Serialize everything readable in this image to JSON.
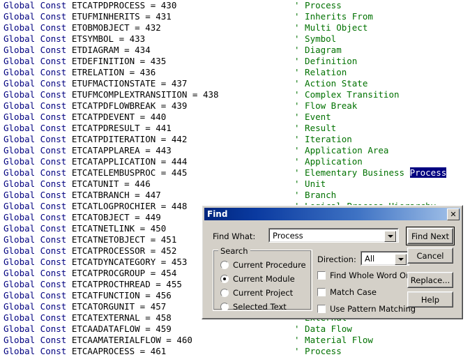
{
  "editor": {
    "keyword": "Global Const",
    "lines": [
      {
        "code": "Global Const ETCATPDPROCESS = 430",
        "ident": "ETCATPDPROCESS",
        "value": "430",
        "comment": "' Process"
      },
      {
        "code": "Global Const ETUFMINHERITS = 431",
        "ident": "ETUFMINHERITS",
        "value": "431",
        "comment": "' Inherits From"
      },
      {
        "code": "Global Const ETOBMOBJECT = 432",
        "ident": "ETOBMOBJECT",
        "value": "432",
        "comment": "' Multi Object"
      },
      {
        "code": "Global Const ETSYMBOL = 433",
        "ident": "ETSYMBOL",
        "value": "433",
        "comment": "' Symbol"
      },
      {
        "code": "Global Const ETDIAGRAM = 434",
        "ident": "ETDIAGRAM",
        "value": "434",
        "comment": "' Diagram"
      },
      {
        "code": "Global Const ETDEFINITION = 435",
        "ident": "ETDEFINITION",
        "value": "435",
        "comment": "' Definition"
      },
      {
        "code": "Global Const ETRELATION = 436",
        "ident": "ETRELATION",
        "value": "436",
        "comment": "' Relation"
      },
      {
        "code": "Global Const ETUFMACTIONSTATE = 437",
        "ident": "ETUFMACTIONSTATE",
        "value": "437",
        "comment": "' Action State"
      },
      {
        "code": "Global Const ETUFMCOMPLEXTRANSITION = 438",
        "ident": "ETUFMCOMPLEXTRANSITION",
        "value": "438",
        "comment": "' Complex Transition"
      },
      {
        "code": "Global Const ETCATPDFLOWBREAK = 439",
        "ident": "ETCATPDFLOWBREAK",
        "value": "439",
        "comment": "' Flow Break"
      },
      {
        "code": "Global Const ETCATPDEVENT = 440",
        "ident": "ETCATPDEVENT",
        "value": "440",
        "comment": "' Event"
      },
      {
        "code": "Global Const ETCATPDRESULT = 441",
        "ident": "ETCATPDRESULT",
        "value": "441",
        "comment": "' Result"
      },
      {
        "code": "Global Const ETCATPDITERATION = 442",
        "ident": "ETCATPDITERATION",
        "value": "442",
        "comment": "' Iteration"
      },
      {
        "code": "Global Const ETCATAPPLAREA = 443",
        "ident": "ETCATAPPLAREA",
        "value": "443",
        "comment": "' Application Area"
      },
      {
        "code": "Global Const ETCATAPPLICATION = 444",
        "ident": "ETCATAPPLICATION",
        "value": "444",
        "comment": "' Application"
      },
      {
        "code": "Global Const ETCATELEMBUSPROC = 445",
        "ident": "ETCATELEMBUSPROC",
        "value": "445",
        "comment": "' Elementary Business Process",
        "comment_prefix": "' Elementary Business ",
        "comment_highlight": "Process"
      },
      {
        "code": "Global Const ETCATUNIT = 446",
        "ident": "ETCATUNIT",
        "value": "446",
        "comment": "' Unit"
      },
      {
        "code": "Global Const ETCATBRANCH = 447",
        "ident": "ETCATBRANCH",
        "value": "447",
        "comment": "' Branch"
      },
      {
        "code": "Global Const ETCATLOGPROCHIER = 448",
        "ident": "ETCATLOGPROCHIER",
        "value": "448",
        "comment": "' Logical Process Hierarchy"
      },
      {
        "code": "Global Const ETCATOBJECT = 449",
        "ident": "ETCATOBJECT",
        "value": "449",
        "comment": ""
      },
      {
        "code": "Global Const ETCATNETLINK = 450",
        "ident": "ETCATNETLINK",
        "value": "450",
        "comment": ""
      },
      {
        "code": "Global Const ETCATNETOBJECT = 451",
        "ident": "ETCATNETOBJECT",
        "value": "451",
        "comment": ""
      },
      {
        "code": "Global Const ETCATPROCESSOR = 452",
        "ident": "ETCATPROCESSOR",
        "value": "452",
        "comment": ""
      },
      {
        "code": "Global Const ETCATDYNCATEGORY = 453",
        "ident": "ETCATDYNCATEGORY",
        "value": "453",
        "comment": ""
      },
      {
        "code": "Global Const ETCATPROCGROUP = 454",
        "ident": "ETCATPROCGROUP",
        "value": "454",
        "comment": ""
      },
      {
        "code": "Global Const ETCATPROCTHREAD = 455",
        "ident": "ETCATPROCTHREAD",
        "value": "455",
        "comment": ""
      },
      {
        "code": "Global Const ETCATFUNCTION = 456",
        "ident": "ETCATFUNCTION",
        "value": "456",
        "comment": ""
      },
      {
        "code": "Global Const ETCATORGUNIT = 457",
        "ident": "ETCATORGUNIT",
        "value": "457",
        "comment": ""
      },
      {
        "code": "Global Const ETCATEXTERNAL = 458",
        "ident": "ETCATEXTERNAL",
        "value": "458",
        "comment": "' External"
      },
      {
        "code": "Global Const ETCAADATAFLOW = 459",
        "ident": "ETCAADATAFLOW",
        "value": "459",
        "comment": "' Data Flow"
      },
      {
        "code": "Global Const ETCAAMATERIALFLOW = 460",
        "ident": "ETCAAMATERIALFLOW",
        "value": "460",
        "comment": "' Material Flow"
      },
      {
        "code": "Global Const ETCAAPROCESS = 461",
        "ident": "ETCAAPROCESS",
        "value": "461",
        "comment": "' Process"
      }
    ],
    "colors": {
      "keyword": "#000080",
      "identifier": "#000000",
      "comment": "#007100",
      "selection_bg": "#000080",
      "selection_fg": "#ffffff"
    }
  },
  "find_dialog": {
    "title": "Find",
    "close_label": "✕",
    "find_what_label": "Find What:",
    "find_what_value": "Process",
    "direction_label": "Direction:",
    "direction_value": "All",
    "search_group_label": "Search",
    "search_options": [
      {
        "label": "Current Procedure",
        "selected": false
      },
      {
        "label": "Current Module",
        "selected": true
      },
      {
        "label": "Current Project",
        "selected": false
      },
      {
        "label": "Selected Text",
        "selected": false
      }
    ],
    "checkboxes": [
      {
        "label": "Find Whole Word Only",
        "checked": false
      },
      {
        "label": "Match Case",
        "checked": false
      },
      {
        "label": "Use Pattern Matching",
        "checked": false
      }
    ],
    "buttons": [
      {
        "label": "Find Next",
        "default": true
      },
      {
        "label": "Cancel",
        "default": false
      },
      {
        "label": "Replace...",
        "default": false
      },
      {
        "label": "Help",
        "default": false
      }
    ],
    "colors": {
      "face": "#d4d0c8",
      "title_left": "#00267e",
      "title_right": "#a7c5ea"
    }
  }
}
